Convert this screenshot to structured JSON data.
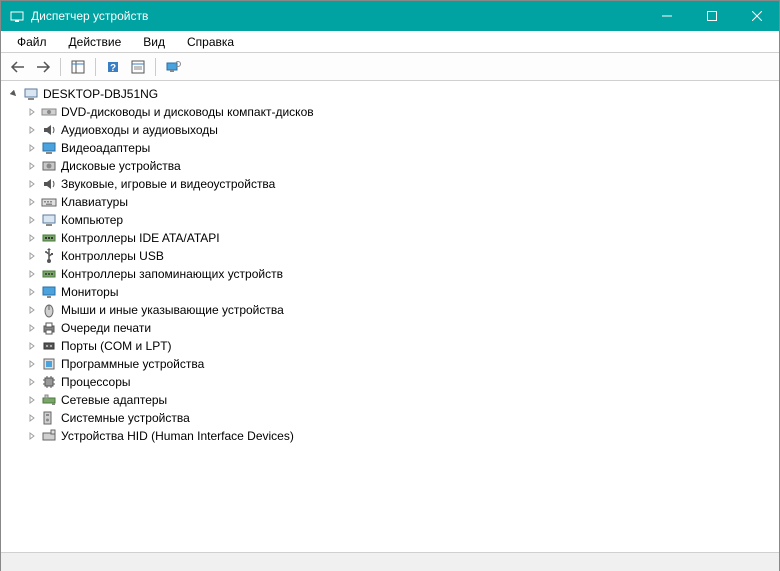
{
  "window": {
    "title": "Диспетчер устройств"
  },
  "menubar": {
    "file": "Файл",
    "action": "Действие",
    "view": "Вид",
    "help": "Справка"
  },
  "tree": {
    "root": "DESKTOP-DBJ51NG",
    "categories": [
      "DVD-дисководы и дисководы компакт-дисков",
      "Аудиовходы и аудиовыходы",
      "Видеоадаптеры",
      "Дисковые устройства",
      "Звуковые, игровые и видеоустройства",
      "Клавиатуры",
      "Компьютер",
      "Контроллеры IDE ATA/ATAPI",
      "Контроллеры USB",
      "Контроллеры запоминающих устройств",
      "Мониторы",
      "Мыши и иные указывающие устройства",
      "Очереди печати",
      "Порты (COM и LPT)",
      "Программные устройства",
      "Процессоры",
      "Сетевые адаптеры",
      "Системные устройства",
      "Устройства HID (Human Interface Devices)"
    ]
  },
  "icons": {
    "dvd": "dvd-drive-icon",
    "audio": "audio-icon",
    "display": "display-adapter-icon",
    "disk": "disk-drive-icon",
    "sound": "sound-icon",
    "keyboard": "keyboard-icon",
    "computer": "computer-icon",
    "ide": "ide-controller-icon",
    "usb": "usb-controller-icon",
    "storage": "storage-controller-icon",
    "monitor": "monitor-icon",
    "mouse": "mouse-icon",
    "printer": "print-queue-icon",
    "port": "port-icon",
    "software": "software-device-icon",
    "cpu": "processor-icon",
    "network": "network-adapter-icon",
    "system": "system-device-icon",
    "hid": "hid-device-icon"
  }
}
